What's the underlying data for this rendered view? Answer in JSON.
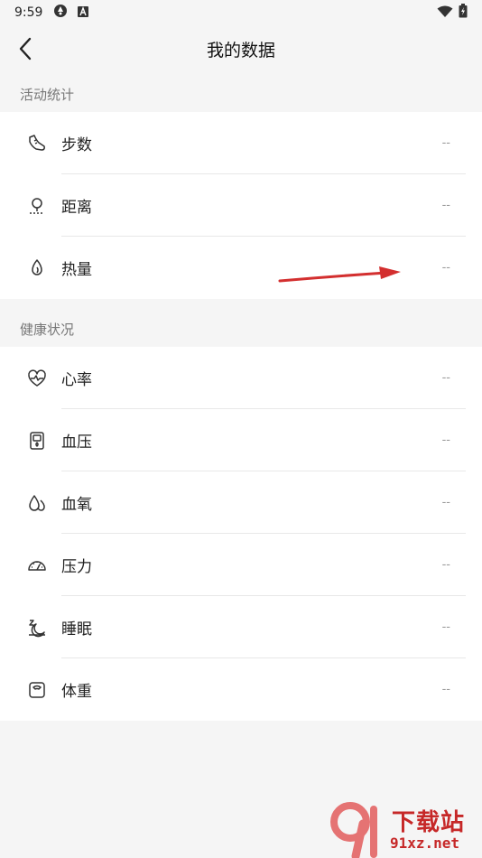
{
  "status_bar": {
    "time": "9:59"
  },
  "header": {
    "title": "我的数据"
  },
  "sections": [
    {
      "title": "活动统计",
      "items": [
        {
          "label": "步数",
          "value": "--",
          "icon": "shoe-icon"
        },
        {
          "label": "距离",
          "value": "--",
          "icon": "location-pin-icon"
        },
        {
          "label": "热量",
          "value": "--",
          "icon": "flame-icon"
        }
      ]
    },
    {
      "title": "健康状况",
      "items": [
        {
          "label": "心率",
          "value": "--",
          "icon": "heart-rate-icon"
        },
        {
          "label": "血压",
          "value": "--",
          "icon": "blood-pressure-icon"
        },
        {
          "label": "血氧",
          "value": "--",
          "icon": "blood-oxygen-icon"
        },
        {
          "label": "压力",
          "value": "--",
          "icon": "gauge-icon"
        },
        {
          "label": "睡眠",
          "value": "--",
          "icon": "sleep-icon"
        },
        {
          "label": "体重",
          "value": "--",
          "icon": "scale-icon"
        }
      ]
    }
  ],
  "watermark": {
    "text": "下载站",
    "url": "91xz.net"
  },
  "colors": {
    "background": "#f5f5f5",
    "card": "#ffffff",
    "annotation": "#d32f2f"
  }
}
